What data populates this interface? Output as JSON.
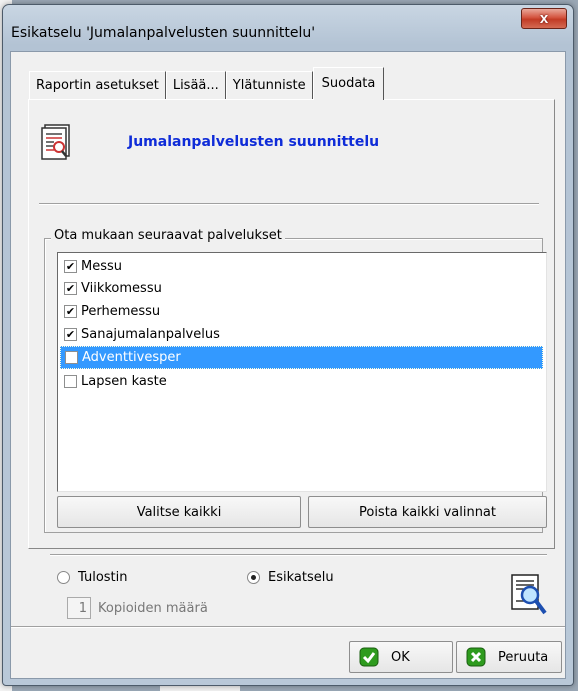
{
  "window": {
    "title": "Esikatselu 'Jumalanpalvelusten suunnittelu'",
    "close_label": "x"
  },
  "tabs": [
    {
      "label": "Raportin asetukset",
      "active": false
    },
    {
      "label": "Lisää...",
      "active": false
    },
    {
      "label": "Ylätunniste",
      "active": false
    },
    {
      "label": "Suodata",
      "active": true
    }
  ],
  "report": {
    "title": "Jumalanpalvelusten suunnittelu",
    "icon": "report-icon"
  },
  "services_group": {
    "title": "Ota mukaan seuraavat palvelukset",
    "items": [
      {
        "label": "Messu",
        "checked": true,
        "selected": false
      },
      {
        "label": "Viikkomessu",
        "checked": true,
        "selected": false
      },
      {
        "label": "Perhemessu",
        "checked": true,
        "selected": false
      },
      {
        "label": "Sanajumalanpalvelus",
        "checked": true,
        "selected": false
      },
      {
        "label": "Adventtivesper",
        "checked": false,
        "selected": true
      },
      {
        "label": "Lapsen kaste",
        "checked": false,
        "selected": false
      }
    ],
    "select_all_label": "Valitse kaikki",
    "clear_all_label": "Poista kaikki valinnat"
  },
  "output": {
    "printer_label": "Tulostin",
    "preview_label": "Esikatselu",
    "selected": "Esikatselu",
    "copies_value": "1",
    "copies_label": "Kopioiden määrä"
  },
  "buttons": {
    "ok_label": "OK",
    "cancel_label": "Peruuta"
  },
  "colors": {
    "accent": "#0f2cd8",
    "selection": "#3399ff",
    "ok_icon": "#2e9b1e",
    "cancel_icon": "#2e9b1e"
  }
}
